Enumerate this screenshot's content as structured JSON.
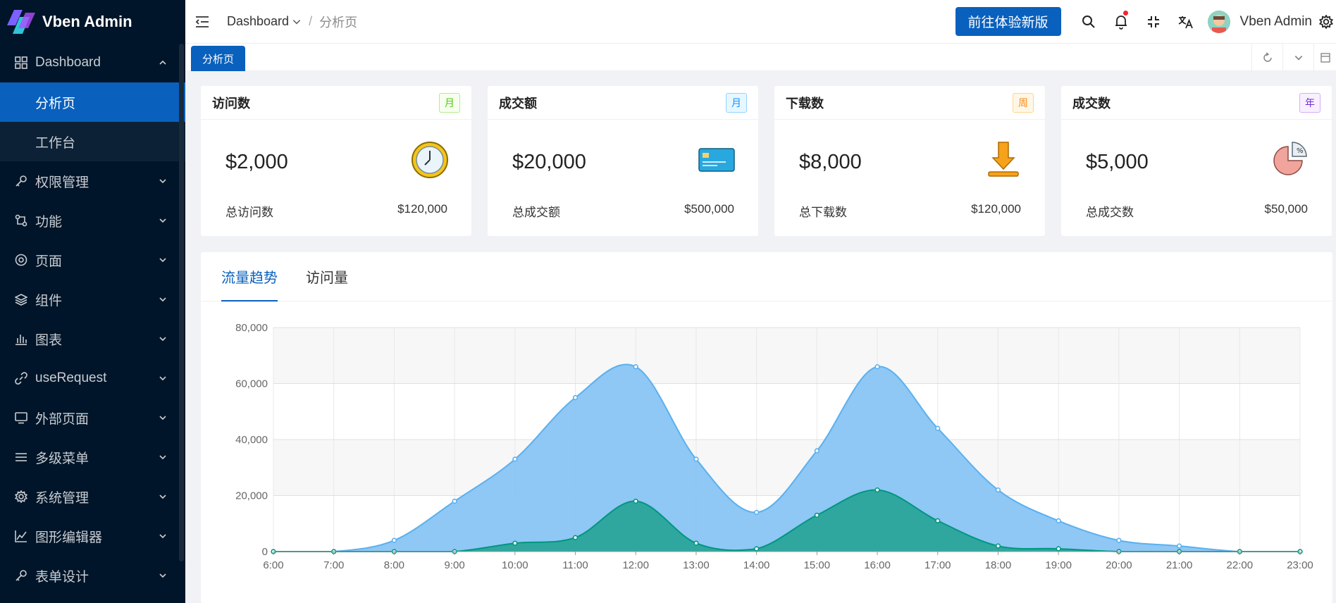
{
  "app": {
    "title": "Vben Admin"
  },
  "sidebar": {
    "items": [
      {
        "label": "Dashboard",
        "icon": "dashboard-icon",
        "expanded": true,
        "children": [
          {
            "label": "分析页",
            "active": true
          },
          {
            "label": "工作台"
          }
        ]
      },
      {
        "label": "权限管理",
        "icon": "key-icon"
      },
      {
        "label": "功能",
        "icon": "function-icon"
      },
      {
        "label": "页面",
        "icon": "page-icon"
      },
      {
        "label": "组件",
        "icon": "layers-icon"
      },
      {
        "label": "图表",
        "icon": "chart-icon"
      },
      {
        "label": "useRequest",
        "icon": "link-icon"
      },
      {
        "label": "外部页面",
        "icon": "monitor-icon"
      },
      {
        "label": "多级菜单",
        "icon": "menu-icon"
      },
      {
        "label": "系统管理",
        "icon": "settings-icon"
      },
      {
        "label": "图形编辑器",
        "icon": "graph-icon"
      },
      {
        "label": "表单设计",
        "icon": "form-icon"
      }
    ]
  },
  "header": {
    "breadcrumb": [
      "Dashboard",
      "分析页"
    ],
    "new_version_button": "前往体验新版",
    "user_name": "Vben Admin"
  },
  "tabs": {
    "active": "分析页"
  },
  "cards": [
    {
      "title": "访问数",
      "tag": "月",
      "tag_color": "#52c41a",
      "value": "$2,000",
      "foot_label": "总访问数",
      "foot_value": "$120,000",
      "icon": "clock-icon"
    },
    {
      "title": "成交额",
      "tag": "月",
      "tag_color": "#1890ff",
      "value": "$20,000",
      "foot_label": "总成交额",
      "foot_value": "$500,000",
      "icon": "credit-card-icon"
    },
    {
      "title": "下载数",
      "tag": "周",
      "tag_color": "#fa8c16",
      "value": "$8,000",
      "foot_label": "总下载数",
      "foot_value": "$120,000",
      "icon": "download-icon"
    },
    {
      "title": "成交数",
      "tag": "年",
      "tag_color": "#722ed1",
      "value": "$5,000",
      "foot_label": "总成交数",
      "foot_value": "$50,000",
      "icon": "pie-icon"
    }
  ],
  "chart_tabs": [
    "流量趋势",
    "访问量"
  ],
  "chart_data": {
    "type": "area",
    "categories": [
      "6:00",
      "7:00",
      "8:00",
      "9:00",
      "10:00",
      "11:00",
      "12:00",
      "13:00",
      "14:00",
      "15:00",
      "16:00",
      "17:00",
      "18:00",
      "19:00",
      "20:00",
      "21:00",
      "22:00",
      "23:00"
    ],
    "series": [
      {
        "values": [
          0,
          0,
          4000,
          18000,
          33000,
          55000,
          66000,
          33000,
          14000,
          36000,
          66000,
          44000,
          22000,
          11000,
          4000,
          2000,
          0,
          0
        ],
        "color": "#5ab1ef"
      },
      {
        "values": [
          0,
          0,
          0,
          0,
          3000,
          5000,
          18000,
          3000,
          1000,
          13000,
          22000,
          11000,
          2000,
          1000,
          0,
          0,
          0,
          0
        ],
        "color": "#019680"
      }
    ],
    "yticks": [
      "0",
      "20,000",
      "40,000",
      "60,000",
      "80,000"
    ],
    "ylim": [
      0,
      80000
    ],
    "grid": true
  }
}
